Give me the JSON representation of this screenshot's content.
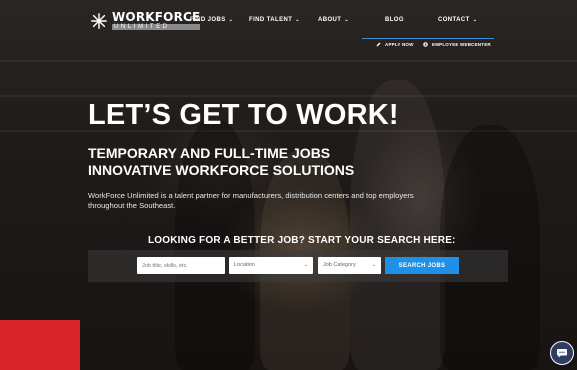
{
  "brand": {
    "name": "WORKFORCE",
    "sub": "UNLIMITED",
    "logo_icon": "star-burst-logo-icon"
  },
  "nav": {
    "items": [
      {
        "label": "FIND JOBS",
        "has_dropdown": true
      },
      {
        "label": "FIND TALENT",
        "has_dropdown": true
      },
      {
        "label": "ABOUT",
        "has_dropdown": true
      },
      {
        "label": "BLOG",
        "has_dropdown": false
      },
      {
        "label": "CONTACT",
        "has_dropdown": true
      }
    ],
    "sub_links": [
      {
        "label": "APPLY NOW",
        "icon": "pencil-icon"
      },
      {
        "label": "EMPLOYEE WEBCENTER",
        "icon": "user-icon"
      }
    ]
  },
  "hero": {
    "title": "LET’S GET TO WORK!",
    "subtitle_line1": "TEMPORARY AND FULL-TIME JOBS",
    "subtitle_line2": "INNOVATIVE WORKFORCE SOLUTIONS",
    "description": "WorkForce Unlimited is a talent partner for manufacturers, distribution centers and top employers throughout the Southeast."
  },
  "search": {
    "heading": "LOOKING FOR A BETTER JOB? START YOUR SEARCH HERE:",
    "keyword_placeholder": "Job title, skills, etc.",
    "location_label": "Location",
    "category_label": "Job Category",
    "button_label": "SEARCH JOBS"
  },
  "colors": {
    "accent_blue": "#1e90e6",
    "red_block": "#d9242a",
    "chat_bg": "#2e3d60"
  },
  "chat": {
    "icon": "chat-bubble-icon"
  }
}
